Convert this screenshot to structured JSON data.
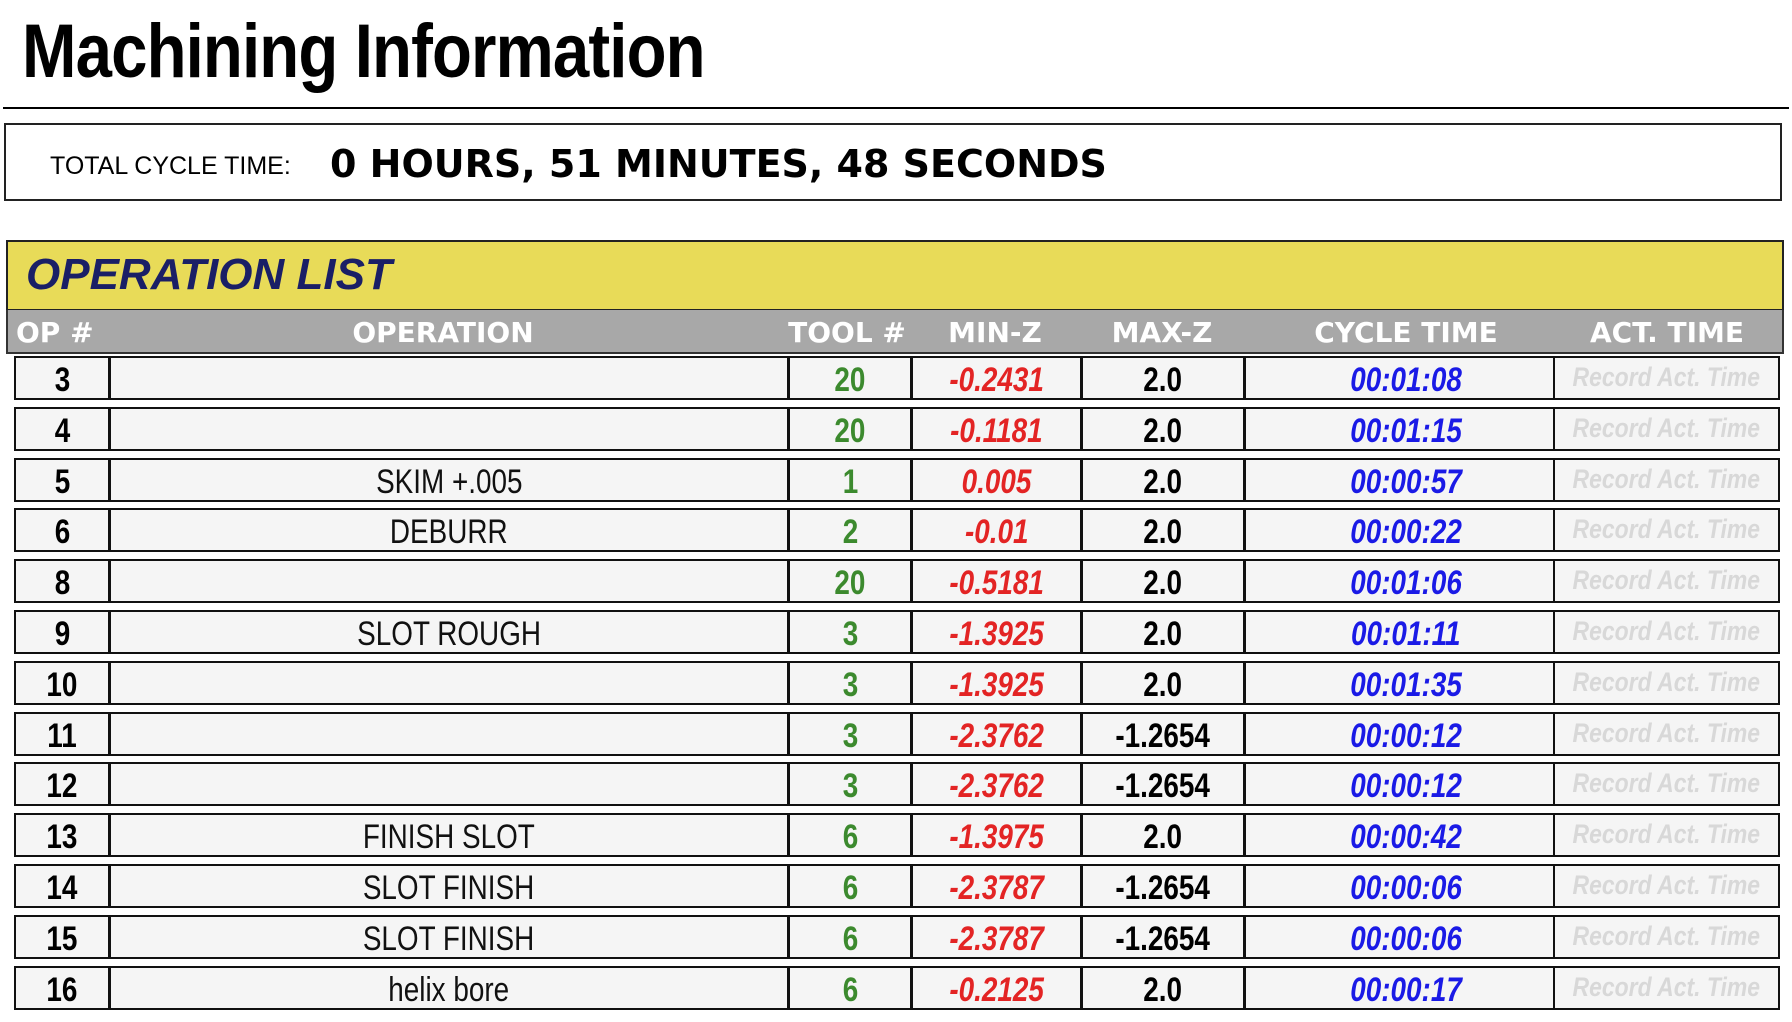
{
  "page": {
    "title": "Machining Information"
  },
  "summary": {
    "label": "TOTAL CYCLE TIME:",
    "value": "0 HOURS, 51 MINUTES, 48 SECONDS"
  },
  "operation_list": {
    "title": "OPERATION LIST",
    "columns": {
      "op": "OP #",
      "operation": "OPERATION",
      "tool": "TOOL #",
      "min_z": "MIN-Z",
      "max_z": "MAX-Z",
      "cycle_time": "CYCLE TIME",
      "act_time": "ACT. TIME"
    },
    "act_time_placeholder": "Record Act. Time",
    "rows": [
      {
        "op": "3",
        "operation": "",
        "tool": "20",
        "min_z": "-0.2431",
        "max_z": "2.0",
        "cycle_time": "00:01:08"
      },
      {
        "op": "4",
        "operation": "",
        "tool": "20",
        "min_z": "-0.1181",
        "max_z": "2.0",
        "cycle_time": "00:01:15"
      },
      {
        "op": "5",
        "operation": "SKIM +.005",
        "tool": "1",
        "min_z": "0.005",
        "max_z": "2.0",
        "cycle_time": "00:00:57"
      },
      {
        "op": "6",
        "operation": "DEBURR",
        "tool": "2",
        "min_z": "-0.01",
        "max_z": "2.0",
        "cycle_time": "00:00:22"
      },
      {
        "op": "8",
        "operation": "",
        "tool": "20",
        "min_z": "-0.5181",
        "max_z": "2.0",
        "cycle_time": "00:01:06"
      },
      {
        "op": "9",
        "operation": "SLOT ROUGH",
        "tool": "3",
        "min_z": "-1.3925",
        "max_z": "2.0",
        "cycle_time": "00:01:11"
      },
      {
        "op": "10",
        "operation": "",
        "tool": "3",
        "min_z": "-1.3925",
        "max_z": "2.0",
        "cycle_time": "00:01:35"
      },
      {
        "op": "11",
        "operation": "",
        "tool": "3",
        "min_z": "-2.3762",
        "max_z": "-1.2654",
        "cycle_time": "00:00:12"
      },
      {
        "op": "12",
        "operation": "",
        "tool": "3",
        "min_z": "-2.3762",
        "max_z": "-1.2654",
        "cycle_time": "00:00:12"
      },
      {
        "op": "13",
        "operation": "FINISH SLOT",
        "tool": "6",
        "min_z": "-1.3975",
        "max_z": "2.0",
        "cycle_time": "00:00:42"
      },
      {
        "op": "14",
        "operation": "SLOT FINISH",
        "tool": "6",
        "min_z": "-2.3787",
        "max_z": "-1.2654",
        "cycle_time": "00:00:06"
      },
      {
        "op": "15",
        "operation": "SLOT FINISH",
        "tool": "6",
        "min_z": "-2.3787",
        "max_z": "-1.2654",
        "cycle_time": "00:00:06"
      },
      {
        "op": "16",
        "operation": "helix bore",
        "tool": "6",
        "min_z": "-0.2125",
        "max_z": "2.0",
        "cycle_time": "00:00:17"
      }
    ]
  },
  "colors": {
    "section_header_bg": "#e8db58",
    "section_title": "#1a1f66",
    "column_header_bg": "#a8a8a8",
    "tool": "#3c8a2e",
    "min_z": "#e32424",
    "cycle_time": "#1a1ae6",
    "act_time_placeholder": "#d8d8d8"
  }
}
